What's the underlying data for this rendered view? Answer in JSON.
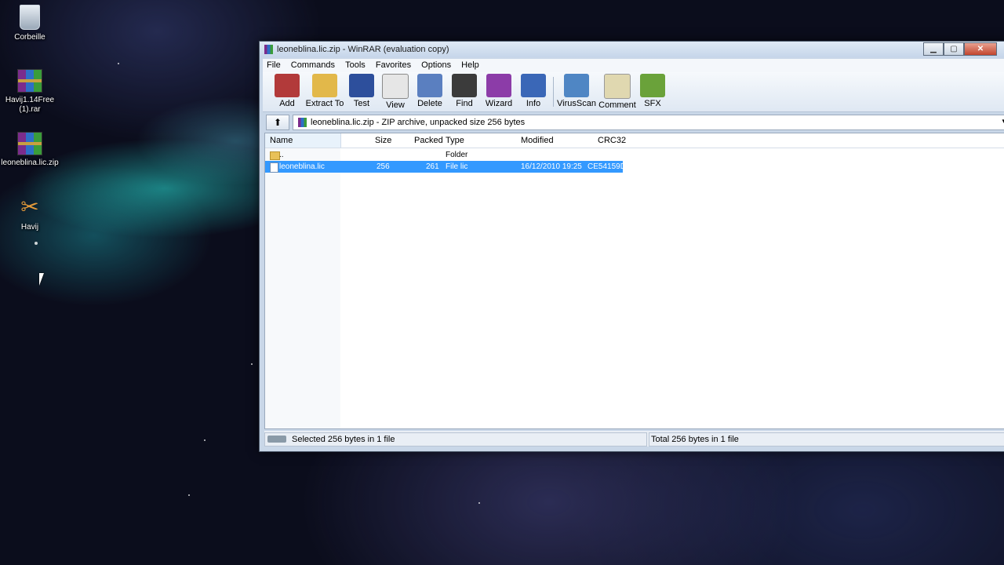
{
  "desktop": {
    "icons": [
      {
        "label": "Corbeille",
        "icon": "recycle-bin-icon"
      },
      {
        "label": "Havij1.14Free (1).rar",
        "icon": "winrar-archive-icon"
      },
      {
        "label": "leoneblina.lic.zip",
        "icon": "winrar-archive-icon"
      },
      {
        "label": "Havij",
        "icon": "havij-shortcut-icon"
      }
    ]
  },
  "window": {
    "title": "leoneblina.lic.zip - WinRAR (evaluation copy)",
    "buttons": {
      "minimize": "▁",
      "maximize": "▢",
      "close": "✕"
    },
    "menu": [
      "File",
      "Commands",
      "Tools",
      "Favorites",
      "Options",
      "Help"
    ],
    "toolbar": [
      {
        "label": "Add",
        "icon": "add-archive-icon",
        "color": "#b23a3a"
      },
      {
        "label": "Extract To",
        "icon": "extract-folder-icon",
        "color": "#e2b84a"
      },
      {
        "label": "Test",
        "icon": "test-book-icon",
        "color": "#2d4f9c"
      },
      {
        "label": "View",
        "icon": "view-glasses-icon",
        "color": "#8a8a8a"
      },
      {
        "label": "Delete",
        "icon": "delete-icon",
        "color": "#5a7fc0"
      },
      {
        "label": "Find",
        "icon": "find-binoculars-icon",
        "color": "#3b3b3b"
      },
      {
        "label": "Wizard",
        "icon": "wizard-icon",
        "color": "#8c3ca8"
      },
      {
        "label": "Info",
        "icon": "info-icon",
        "color": "#3a67b7"
      },
      {
        "label": "VirusScan",
        "icon": "virusscan-icon",
        "color": "#4f86c4"
      },
      {
        "label": "Comment",
        "icon": "comment-icon",
        "color": "#e0d8b0"
      },
      {
        "label": "SFX",
        "icon": "sfx-icon",
        "color": "#6aa23a"
      }
    ],
    "address": {
      "up_label": "⬆",
      "text": "leoneblina.lic.zip - ZIP archive, unpacked size 256 bytes",
      "dropdown": "▾"
    },
    "columns": {
      "name": "Name",
      "size": "Size",
      "packed": "Packed",
      "type": "Type",
      "modified": "Modified",
      "crc": "CRC32"
    },
    "rows": [
      {
        "name": "..",
        "size": "",
        "packed": "",
        "type": "Folder",
        "modified": "",
        "crc": ""
      },
      {
        "name": "leoneblina.lic",
        "size": "256",
        "packed": "261",
        "type": "File lic",
        "modified": "16/12/2010 19:25",
        "crc": "CE54159D"
      }
    ],
    "status": {
      "left": "Selected 256 bytes in 1 file",
      "right": "Total 256 bytes in 1 file"
    }
  }
}
